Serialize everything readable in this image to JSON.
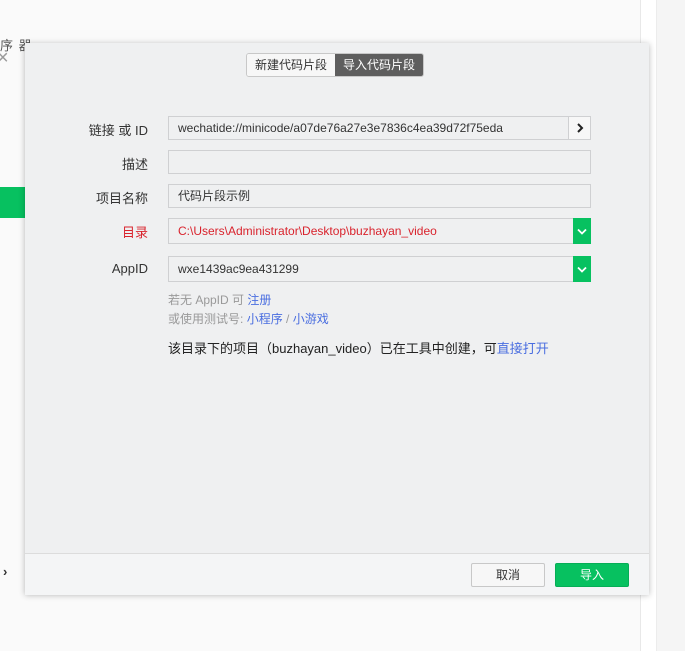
{
  "background": {
    "partial_text": "序 器",
    "close_icon": "×",
    "side_arrow": "›"
  },
  "tabs": [
    {
      "label": "新建代码片段",
      "active": false
    },
    {
      "label": "导入代码片段",
      "active": true
    }
  ],
  "form": {
    "link_label": "链接 或 ID",
    "link_value": "wechatide://minicode/a07de76a27e3e7836c4ea39d72f75eda",
    "desc_label": "描述",
    "desc_value": "",
    "name_label": "项目名称",
    "name_value": "代码片段示例",
    "dir_label": "目录",
    "dir_value": "C:\\Users\\Administrator\\Desktop\\buzhayan_video",
    "appid_label": "AppID",
    "appid_value": "wxe1439ac9ea431299"
  },
  "hints": {
    "no_appid": "若无 AppID 可",
    "register": "注册",
    "test_prefix": "或使用测试号:",
    "miniprogram": "小程序",
    "slash": "/",
    "minigame": "小游戏"
  },
  "notice": {
    "text": "该目录下的项目（buzhayan_video）已在工具中创建，可",
    "link": "直接打开"
  },
  "footer": {
    "cancel": "取消",
    "import": "导入"
  },
  "colors": {
    "accent": "#07c160",
    "error": "#d9232d",
    "link": "#4a6ee0"
  }
}
